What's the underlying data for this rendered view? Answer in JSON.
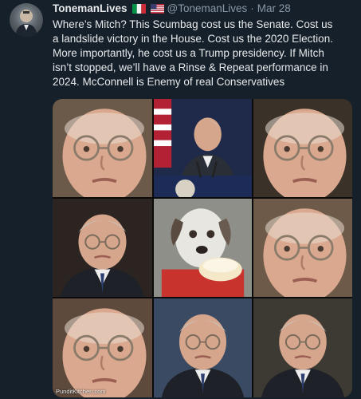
{
  "tweet": {
    "display_name": "TonemanLives",
    "handle": "@TonemanLives",
    "separator": "·",
    "date": "Mar 28",
    "flag_icons": [
      "flag-italy-icon",
      "flag-usa-icon"
    ],
    "text_lines": [
      "Where’s Mitch? This Scumbag cost us the Senate. Cost us",
      "a landslide victory in the House. Cost us the 2020 Election.",
      "More importantly, he cost us a Trump presidency. If Mitch",
      "isn’t stopped, we’ll have a Rinse & Repeat performance in",
      "2024. McConnell is Enemy of real Conservatives"
    ]
  },
  "media": {
    "caption": "PunditKitchen.com",
    "tiles": [
      {
        "name": "photo-tile-closeup-face",
        "type": "face",
        "bg": "#6b5a4a"
      },
      {
        "name": "photo-tile-podium-speech",
        "type": "podium",
        "bg": "#1f2a4a"
      },
      {
        "name": "photo-tile-closeup-side",
        "type": "face",
        "bg": "#3a3128"
      },
      {
        "name": "photo-tile-portrait",
        "type": "portrait",
        "bg": "#2c2420"
      },
      {
        "name": "photo-tile-dog-cake",
        "type": "dog",
        "bg": "#8f8f8a"
      },
      {
        "name": "photo-tile-closeup-glasses",
        "type": "face",
        "bg": "#6e5a48"
      },
      {
        "name": "photo-tile-face-glasses",
        "type": "face",
        "bg": "#5d4a3d"
      },
      {
        "name": "photo-tile-suit-portrait",
        "type": "portrait",
        "bg": "#3b4a63"
      },
      {
        "name": "photo-tile-profile-glasses",
        "type": "portrait",
        "bg": "#3d3a34"
      }
    ]
  }
}
